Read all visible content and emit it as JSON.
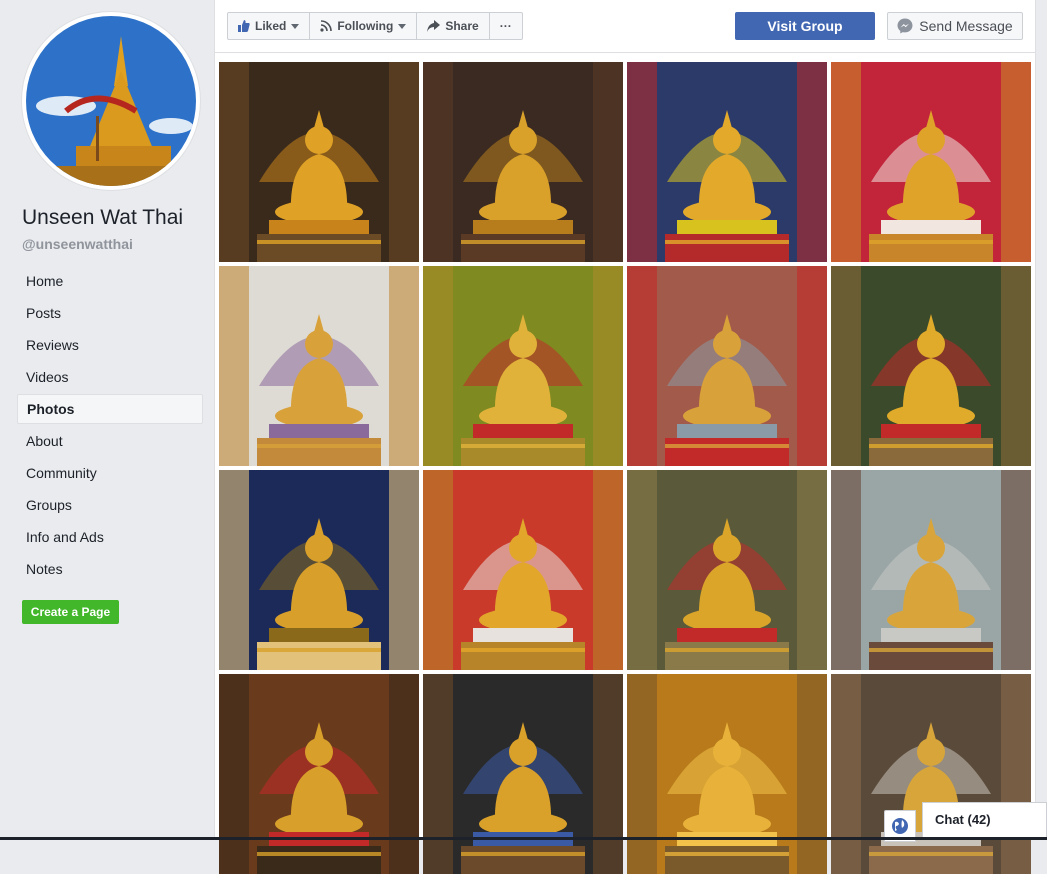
{
  "page": {
    "name": "Unseen Wat Thai",
    "handle": "@unseenwatthai"
  },
  "nav": [
    {
      "label": "Home"
    },
    {
      "label": "Posts"
    },
    {
      "label": "Reviews"
    },
    {
      "label": "Videos"
    },
    {
      "label": "Photos",
      "active": true
    },
    {
      "label": "About"
    },
    {
      "label": "Community"
    },
    {
      "label": "Groups"
    },
    {
      "label": "Info and Ads"
    },
    {
      "label": "Notes"
    }
  ],
  "create_page_label": "Create a Page",
  "actions": {
    "liked_label": "Liked",
    "following_label": "Following",
    "share_label": "Share",
    "more_label": "···",
    "visit_group_label": "Visit Group",
    "send_message_label": "Send Message"
  },
  "photos": [
    {
      "palette": [
        "#3a2a1c",
        "#e0a226",
        "#c8841a",
        "#6b4a26"
      ]
    },
    {
      "palette": [
        "#3b2a22",
        "#d9a02a",
        "#b77d1c",
        "#5a3a24"
      ]
    },
    {
      "palette": [
        "#2c3a6a",
        "#e2a92b",
        "#d8c21e",
        "#b42a2a"
      ]
    },
    {
      "palette": [
        "#c2243a",
        "#e0a32a",
        "#f2e6e0",
        "#c8852a"
      ]
    },
    {
      "palette": [
        "#dedbd4",
        "#d8a13a",
        "#8a6a9a",
        "#c28a3a"
      ]
    },
    {
      "palette": [
        "#7f8a20",
        "#e1b23a",
        "#c22a2a",
        "#a88a2a"
      ]
    },
    {
      "palette": [
        "#a25a4a",
        "#d9a13a",
        "#8a9aa6",
        "#c22a2a"
      ]
    },
    {
      "palette": [
        "#3a4a2a",
        "#e0aa2a",
        "#c22a2a",
        "#8a6a3a"
      ]
    },
    {
      "palette": [
        "#1c2a5a",
        "#d8a02a",
        "#8a6a1a",
        "#e2c27a"
      ]
    },
    {
      "palette": [
        "#c93a2a",
        "#e2a72a",
        "#e8e2de",
        "#b8842a"
      ]
    },
    {
      "palette": [
        "#5a5a3a",
        "#dba52a",
        "#c22a2a",
        "#8a7a4a"
      ]
    },
    {
      "palette": [
        "#9aa6a6",
        "#d9a53a",
        "#c8c8c4",
        "#6a4a3a"
      ]
    },
    {
      "palette": [
        "#6a3a1c",
        "#d8a02a",
        "#c22a2a",
        "#3a2a1a"
      ]
    },
    {
      "palette": [
        "#2a2a2a",
        "#d9a02a",
        "#3a5aa6",
        "#6a4a2a"
      ]
    },
    {
      "palette": [
        "#b87a1a",
        "#e8b23a",
        "#f2c24a",
        "#7a5a2a"
      ]
    },
    {
      "palette": [
        "#5a4a3a",
        "#d8a53a",
        "#c8c2b8",
        "#8a6a4a"
      ]
    }
  ],
  "chat": {
    "label": "Chat (42)"
  }
}
